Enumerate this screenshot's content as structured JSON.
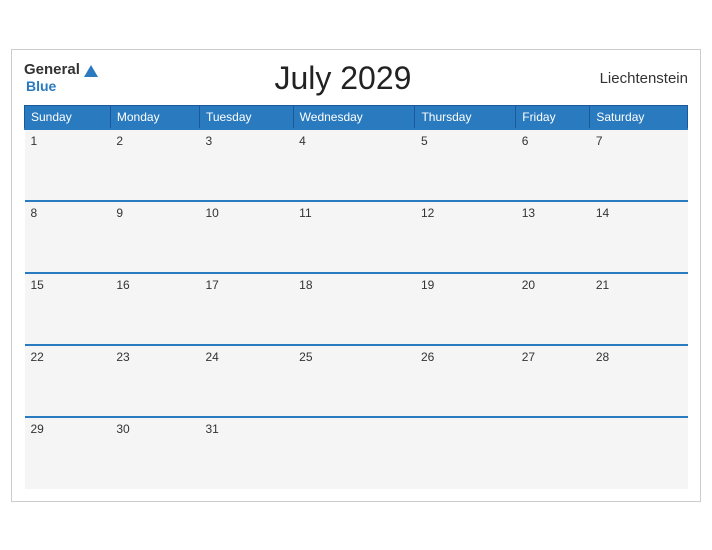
{
  "header": {
    "logo_general": "General",
    "logo_blue": "Blue",
    "title": "July 2029",
    "country": "Liechtenstein"
  },
  "weekdays": [
    "Sunday",
    "Monday",
    "Tuesday",
    "Wednesday",
    "Thursday",
    "Friday",
    "Saturday"
  ],
  "weeks": [
    [
      1,
      2,
      3,
      4,
      5,
      6,
      7
    ],
    [
      8,
      9,
      10,
      11,
      12,
      13,
      14
    ],
    [
      15,
      16,
      17,
      18,
      19,
      20,
      21
    ],
    [
      22,
      23,
      24,
      25,
      26,
      27,
      28
    ],
    [
      29,
      30,
      31,
      null,
      null,
      null,
      null
    ]
  ]
}
